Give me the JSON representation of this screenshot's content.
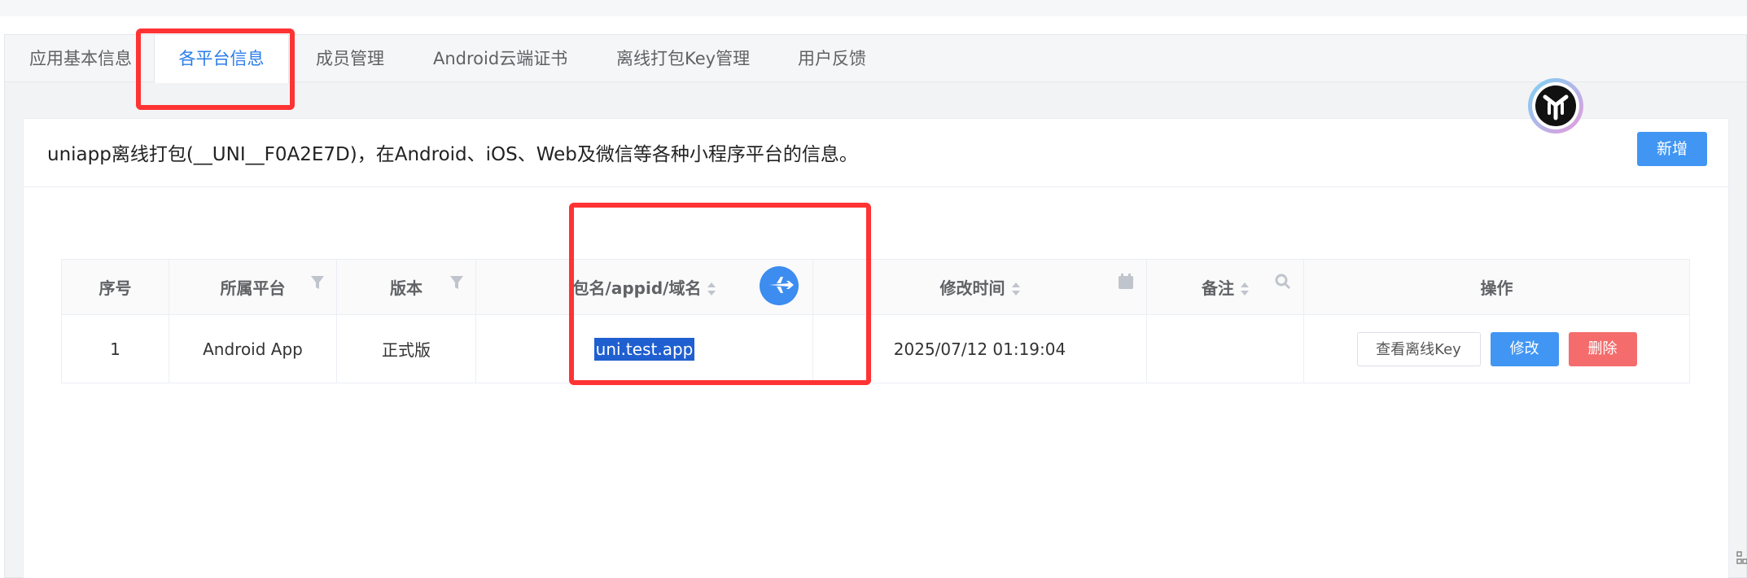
{
  "tabs": [
    {
      "label": "应用基本信息",
      "active": false
    },
    {
      "label": "各平台信息",
      "active": true
    },
    {
      "label": "成员管理",
      "active": false
    },
    {
      "label": "Android云端证书",
      "active": false
    },
    {
      "label": "离线打包Key管理",
      "active": false
    },
    {
      "label": "用户反馈",
      "active": false
    }
  ],
  "panel": {
    "title": "uniapp离线打包(__UNI__F0A2E7D)，在Android、iOS、Web及微信等各种小程序平台的信息。",
    "add_label": "新增"
  },
  "table": {
    "headers": [
      "序号",
      "所属平台",
      "版本",
      "包名/appid/域名",
      "修改时间",
      "备注",
      "操作"
    ],
    "rows": [
      {
        "index": "1",
        "platform": "Android App",
        "version": "正式版",
        "package": "uni.test.app",
        "modified": "2025/07/12 01:19:04",
        "note": "",
        "actions": {
          "view_key": "查看离线Key",
          "edit": "修改",
          "delete": "删除"
        }
      }
    ]
  },
  "icons": {
    "filter": "filter-icon",
    "search": "search-icon",
    "calendar": "calendar-icon",
    "plane": "airplane-icon",
    "logo": "floating-assistant-logo"
  },
  "colors": {
    "primary": "#4196f3",
    "danger": "#f56c6c",
    "tab_active": "#2b7de9",
    "annotation": "#ff3333",
    "selection": "#1f5fd0"
  }
}
